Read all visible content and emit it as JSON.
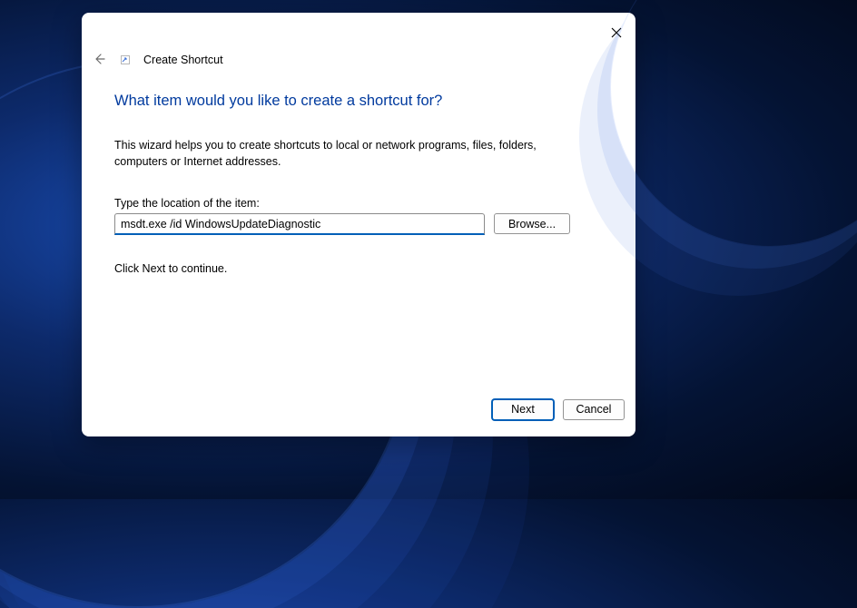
{
  "dialog": {
    "title": "Create Shortcut",
    "heading": "What item would you like to create a shortcut for?",
    "description": "This wizard helps you to create shortcuts to local or network programs, files, folders, computers or Internet addresses.",
    "input_label": "Type the location of the item:",
    "input_value": "msdt.exe /id WindowsUpdateDiagnostic",
    "browse_label": "Browse...",
    "continue_text": "Click Next to continue.",
    "next_label": "Next",
    "cancel_label": "Cancel"
  }
}
